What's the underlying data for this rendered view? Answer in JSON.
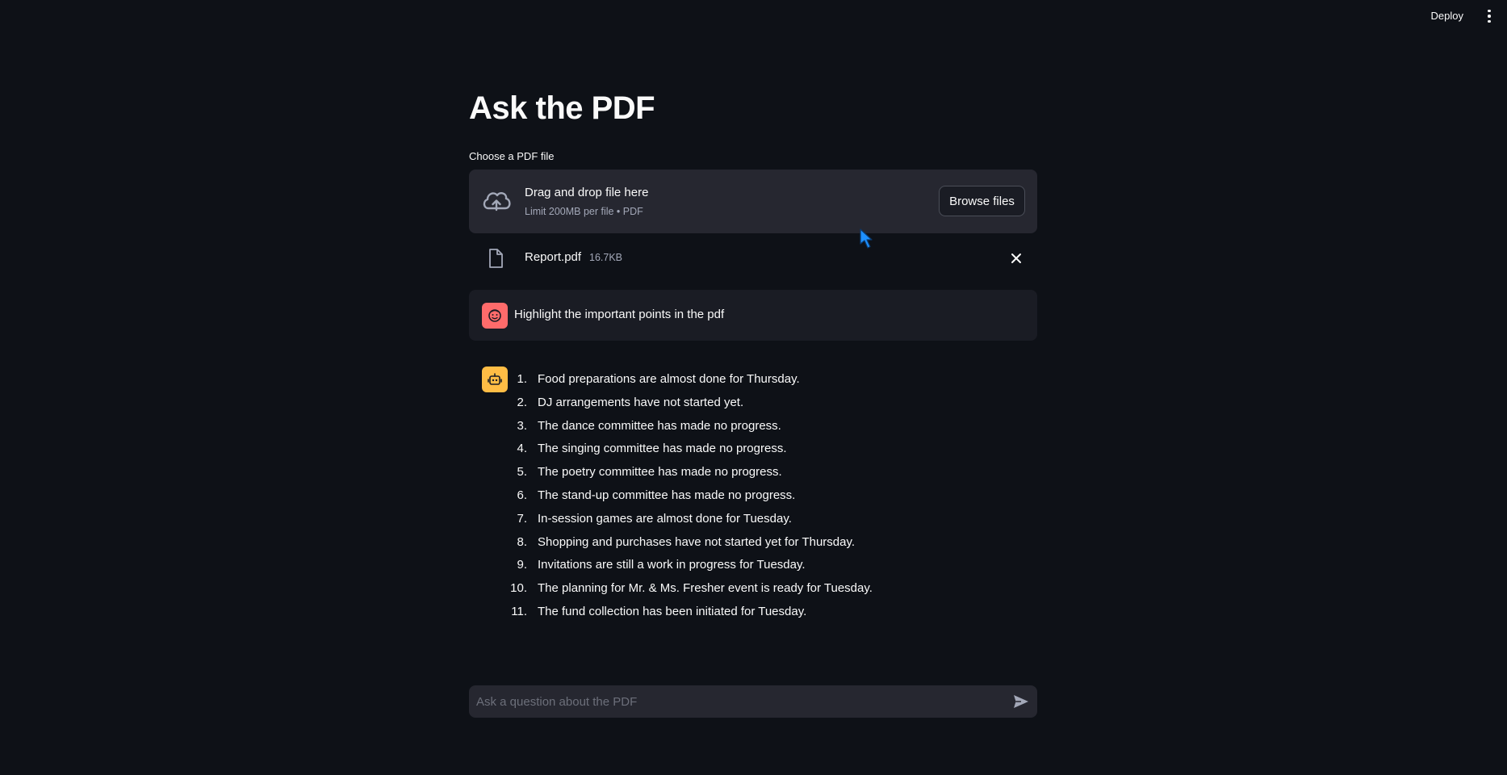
{
  "header": {
    "deploy_label": "Deploy",
    "menu_icon": "vertical-dots-icon"
  },
  "page": {
    "title": "Ask the PDF"
  },
  "uploader": {
    "label": "Choose a PDF file",
    "drop_title": "Drag and drop file here",
    "drop_subtitle": "Limit 200MB per file • PDF",
    "browse_label": "Browse files",
    "icon": "cloud-upload-icon"
  },
  "uploaded_file": {
    "name": "Report.pdf",
    "size": "16.7KB",
    "icon": "file-icon",
    "remove_icon": "close-icon"
  },
  "chat": {
    "user_message": "Highlight the important points in the pdf",
    "user_avatar_color": "#ff6b6b",
    "assistant_avatar_color": "#ffbd45",
    "assistant_items": [
      {
        "num": "1.",
        "text": "Food preparations are almost done for Thursday."
      },
      {
        "num": "2.",
        "text": "DJ arrangements have not started yet."
      },
      {
        "num": "3.",
        "text": "The dance committee has made no progress."
      },
      {
        "num": "4.",
        "text": "The singing committee has made no progress."
      },
      {
        "num": "5.",
        "text": "The poetry committee has made no progress."
      },
      {
        "num": "6.",
        "text": "The stand-up committee has made no progress."
      },
      {
        "num": "7.",
        "text": "In-session games are almost done for Tuesday."
      },
      {
        "num": "8.",
        "text": "Shopping and purchases have not started yet for Thursday."
      },
      {
        "num": "9.",
        "text": "Invitations are still a work in progress for Tuesday."
      },
      {
        "num": "10.",
        "text": "The planning for Mr. & Ms. Fresher event is ready for Tuesday."
      },
      {
        "num": "11.",
        "text": "The fund collection has been initiated for Tuesday."
      }
    ]
  },
  "chat_input": {
    "placeholder": "Ask a question about the PDF",
    "value": "",
    "send_icon": "send-icon"
  },
  "colors": {
    "background": "#0e1117",
    "surface": "#262730",
    "text": "#fafafa",
    "muted": "#a3a8b8"
  }
}
